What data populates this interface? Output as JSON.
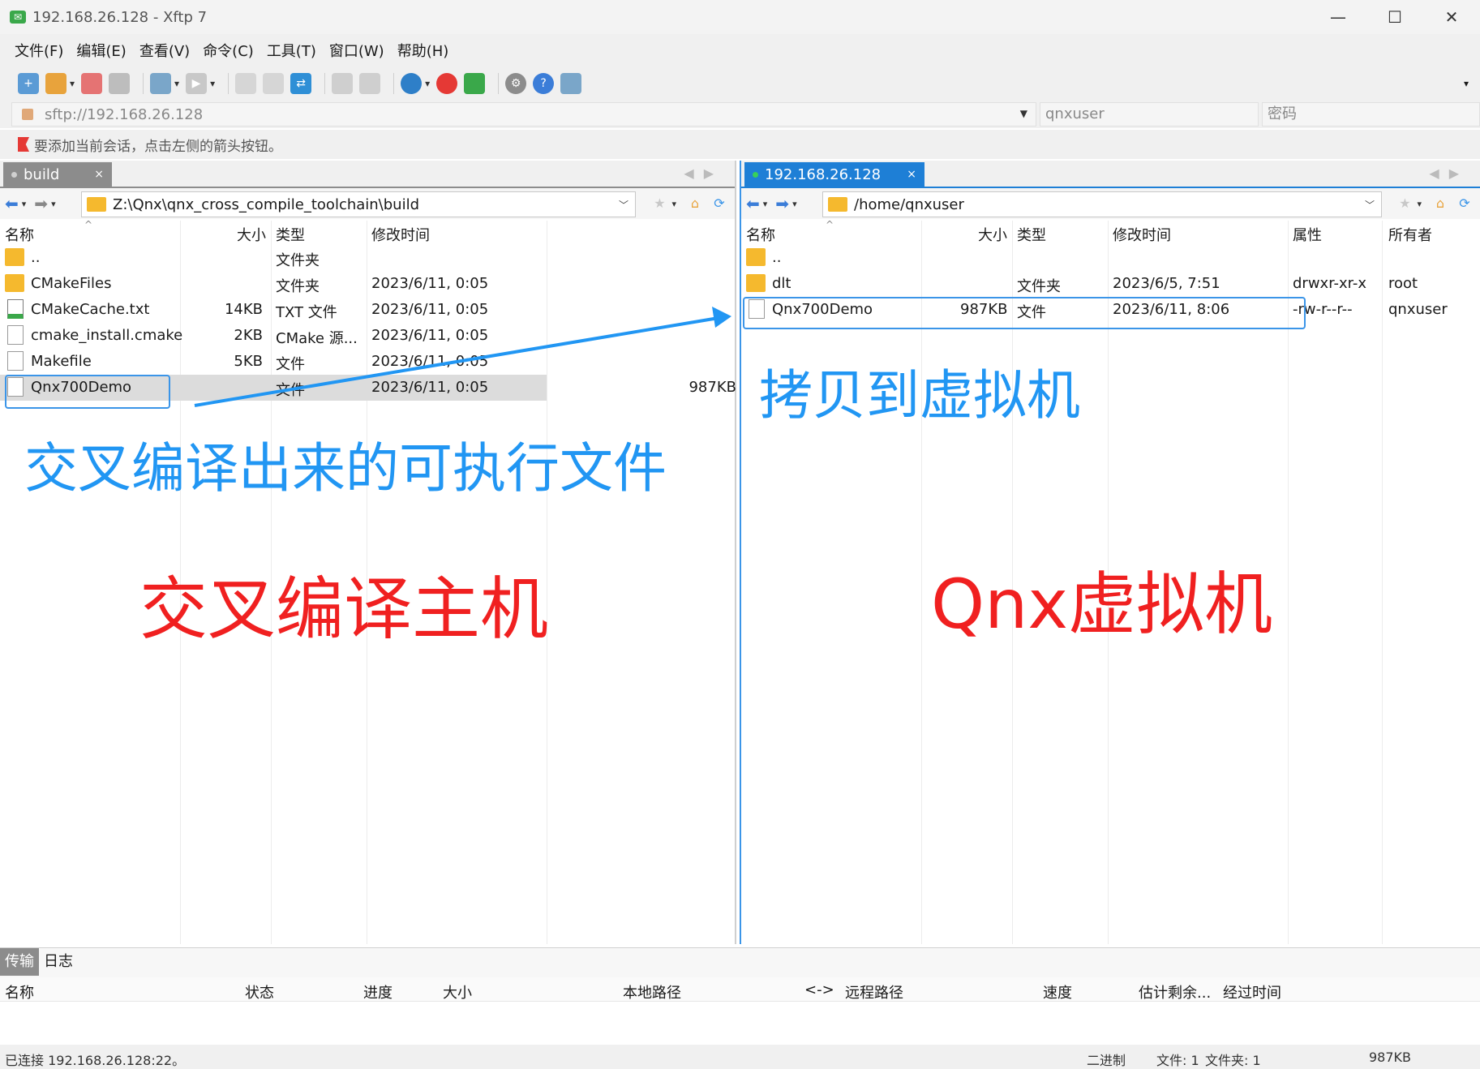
{
  "window": {
    "title": "192.168.26.128 - Xftp 7",
    "app_icon_glyph": "✉"
  },
  "menu": [
    "文件(F)",
    "编辑(E)",
    "查看(V)",
    "命令(C)",
    "工具(T)",
    "窗口(W)",
    "帮助(H)"
  ],
  "address": {
    "url": "sftp://192.168.26.128",
    "username": "qnxuser",
    "password_placeholder": "密码"
  },
  "info_bar": "要添加当前会话，点击左侧的箭头按钮。",
  "left_pane": {
    "tab_label": "build",
    "path": "Z:\\Qnx\\qnx_cross_compile_toolchain\\build",
    "columns": [
      "名称",
      "大小",
      "类型",
      "修改时间"
    ],
    "rows": [
      {
        "name": "..",
        "size": "",
        "type": "文件夹",
        "modified": "",
        "icon": "folder-icon"
      },
      {
        "name": "CMakeFiles",
        "size": "",
        "type": "文件夹",
        "modified": "2023/6/11, 0:05",
        "icon": "folder-icon"
      },
      {
        "name": "CMakeCache.txt",
        "size": "14KB",
        "type": "TXT 文件",
        "modified": "2023/6/11, 0:05",
        "icon": "text-file-icon"
      },
      {
        "name": "cmake_install.cmake",
        "size": "2KB",
        "type": "CMake 源...",
        "modified": "2023/6/11, 0:05",
        "icon": "file-icon"
      },
      {
        "name": "Makefile",
        "size": "5KB",
        "type": "文件",
        "modified": "2023/6/11, 0:05",
        "icon": "file-icon"
      },
      {
        "name": "Qnx700Demo",
        "size": "987KB",
        "type": "文件",
        "modified": "2023/6/11, 0:05",
        "icon": "file-icon"
      }
    ]
  },
  "right_pane": {
    "tab_label": "192.168.26.128",
    "path": "/home/qnxuser",
    "columns": [
      "名称",
      "大小",
      "类型",
      "修改时间",
      "属性",
      "所有者"
    ],
    "rows": [
      {
        "name": "..",
        "size": "",
        "type": "",
        "modified": "",
        "attrs": "",
        "owner": "",
        "icon": "folder-icon"
      },
      {
        "name": "dlt",
        "size": "",
        "type": "文件夹",
        "modified": "2023/6/5, 7:51",
        "attrs": "drwxr-xr-x",
        "owner": "root",
        "icon": "folder-icon"
      },
      {
        "name": "Qnx700Demo",
        "size": "987KB",
        "type": "文件",
        "modified": "2023/6/11, 8:06",
        "attrs": "-rw-r--r--",
        "owner": "qnxuser",
        "icon": "file-icon"
      }
    ]
  },
  "annotations": {
    "left_caption": "交叉编译出来的可执行文件",
    "right_caption": "拷贝到虚拟机",
    "left_host": "交叉编译主机",
    "right_host": "Qnx虚拟机",
    "blue": "#2196f3",
    "red": "#f02020"
  },
  "transfer": {
    "tabs": [
      "传输",
      "日志"
    ],
    "columns": [
      "名称",
      "状态",
      "进度",
      "大小",
      "本地路径",
      "<->",
      "远程路径",
      "速度",
      "估计剩余...",
      "经过时间"
    ]
  },
  "status": {
    "connection": "已连接 192.168.26.128:22。",
    "mode": "二进制",
    "files": "文件: 1",
    "folders": "文件夹: 1",
    "size": "987KB"
  }
}
